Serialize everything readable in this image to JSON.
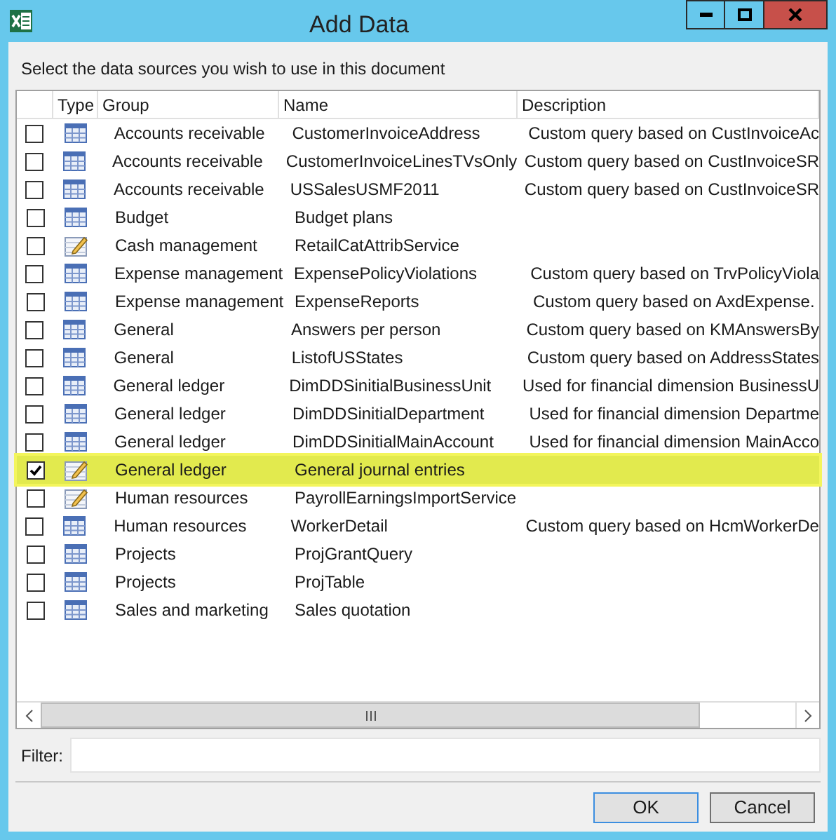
{
  "window": {
    "title": "Add Data"
  },
  "instruction": "Select the data sources you wish to use in this document",
  "table": {
    "columns": [
      "Type",
      "Group",
      "Name",
      "Description"
    ],
    "rows": [
      {
        "checked": false,
        "highlighted": false,
        "kind": "table",
        "group": "Accounts receivable",
        "name": "CustomerInvoiceAddress",
        "description": "Custom query based on CustInvoiceAc"
      },
      {
        "checked": false,
        "highlighted": false,
        "kind": "table",
        "group": "Accounts receivable",
        "name": "CustomerInvoiceLinesTVsOnly",
        "description": "Custom query based on CustInvoiceSR"
      },
      {
        "checked": false,
        "highlighted": false,
        "kind": "table",
        "group": "Accounts receivable",
        "name": "USSalesUSMF2011",
        "description": "Custom query based on CustInvoiceSR"
      },
      {
        "checked": false,
        "highlighted": false,
        "kind": "table",
        "group": "Budget",
        "name": "Budget plans"
      },
      {
        "checked": false,
        "highlighted": false,
        "kind": "service",
        "group": "Cash management",
        "name": "RetailCatAttribService"
      },
      {
        "checked": false,
        "highlighted": false,
        "kind": "table",
        "group": "Expense management",
        "name": "ExpensePolicyViolations",
        "description": "Custom query based on TrvPolicyViola"
      },
      {
        "checked": false,
        "highlighted": false,
        "kind": "table",
        "group": "Expense management",
        "name": "ExpenseReports",
        "description": "Custom query based on AxdExpense."
      },
      {
        "checked": false,
        "highlighted": false,
        "kind": "table",
        "group": "General",
        "name": "Answers per person",
        "description": "Custom query based on KMAnswersBy"
      },
      {
        "checked": false,
        "highlighted": false,
        "kind": "table",
        "group": "General",
        "name": "ListofUSStates",
        "description": "Custom query based on AddressStates"
      },
      {
        "checked": false,
        "highlighted": false,
        "kind": "table",
        "group": "General ledger",
        "name": "DimDDSinitialBusinessUnit",
        "description": "Used for financial dimension BusinessU"
      },
      {
        "checked": false,
        "highlighted": false,
        "kind": "table",
        "group": "General ledger",
        "name": "DimDDSinitialDepartment",
        "description": "Used for financial dimension Departme"
      },
      {
        "checked": false,
        "highlighted": false,
        "kind": "table",
        "group": "General ledger",
        "name": "DimDDSinitialMainAccount",
        "description": "Used for financial dimension MainAcco"
      },
      {
        "checked": true,
        "highlighted": true,
        "kind": "service",
        "group": "General ledger",
        "name": "General journal entries"
      },
      {
        "checked": false,
        "highlighted": false,
        "kind": "service",
        "group": "Human resources",
        "name": "PayrollEarningsImportService"
      },
      {
        "checked": false,
        "highlighted": false,
        "kind": "table",
        "group": "Human resources",
        "name": "WorkerDetail",
        "description": "Custom query based on HcmWorkerDe"
      },
      {
        "checked": false,
        "highlighted": false,
        "kind": "table",
        "group": "Projects",
        "name": "ProjGrantQuery"
      },
      {
        "checked": false,
        "highlighted": false,
        "kind": "table",
        "group": "Projects",
        "name": "ProjTable"
      },
      {
        "checked": false,
        "highlighted": false,
        "kind": "table",
        "group": "Sales and marketing",
        "name": "Sales quotation"
      }
    ]
  },
  "filter": {
    "label": "Filter:"
  },
  "buttons": [
    "OK",
    "Cancel"
  ]
}
